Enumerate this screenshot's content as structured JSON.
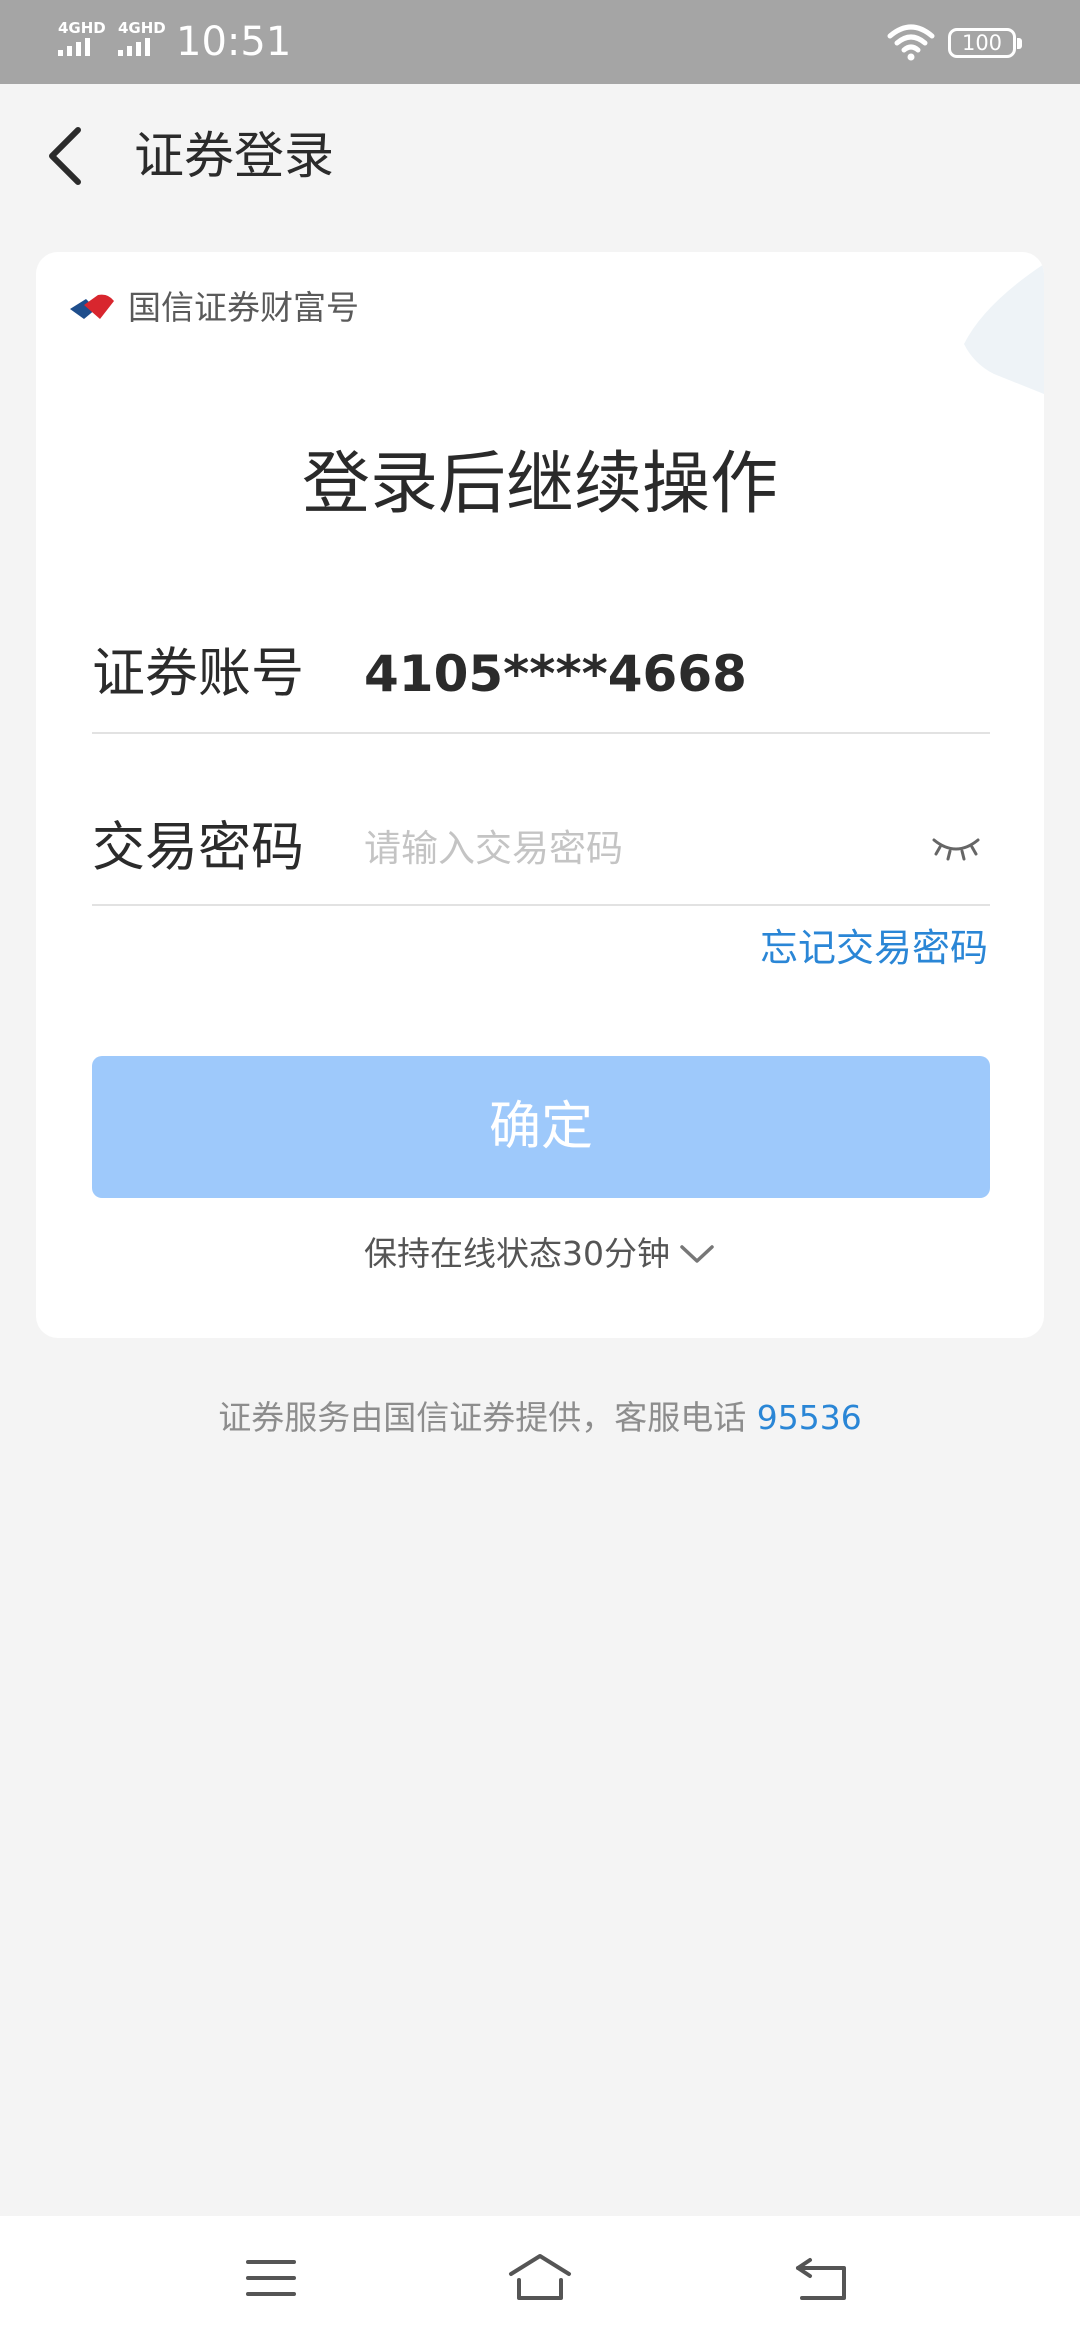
{
  "status_bar": {
    "network_1": "4GHD",
    "network_2": "4GHD",
    "time": "10:51",
    "battery": "100"
  },
  "header": {
    "title": "证券登录"
  },
  "card": {
    "brand_name": "国信证券财富号",
    "headline": "登录后继续操作",
    "account": {
      "label": "证券账号",
      "value": "4105****4668"
    },
    "password": {
      "label": "交易密码",
      "value": "",
      "placeholder": "请输入交易密码"
    },
    "forgot_label": "忘记交易密码",
    "confirm_label": "确定",
    "stay_online_label": "保持在线状态30分钟"
  },
  "footer": {
    "note": "证券服务由国信证券提供，客服电话",
    "phone": "95536"
  },
  "colors": {
    "accent": "#2a86d6",
    "button_disabled": "#9ec9fb",
    "background": "#f4f4f4"
  }
}
